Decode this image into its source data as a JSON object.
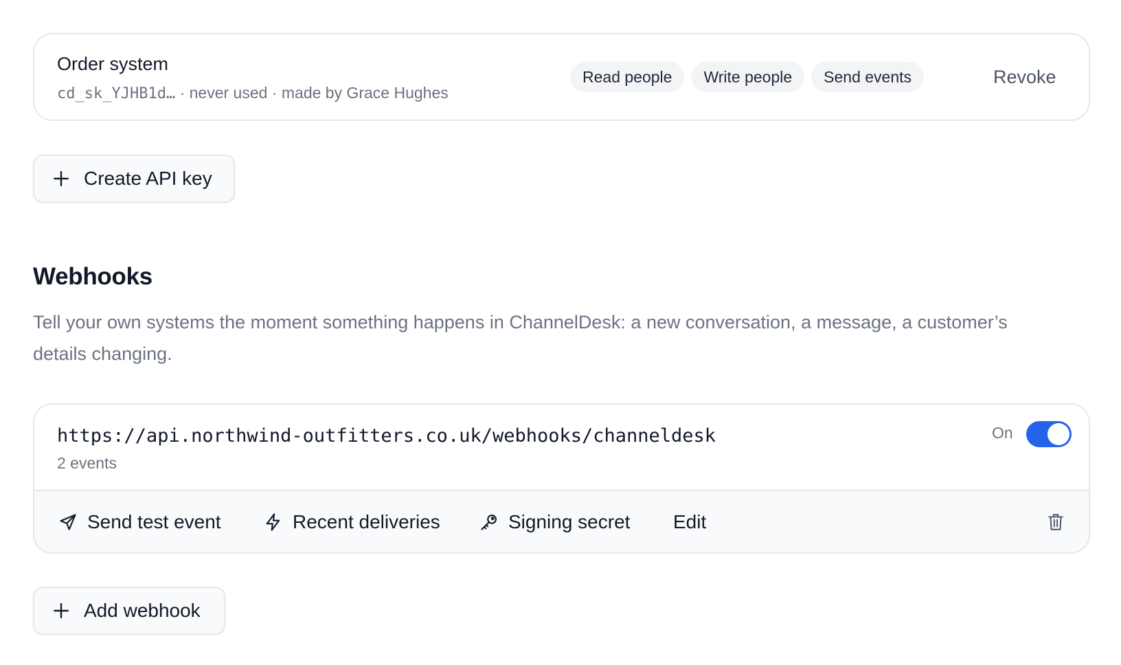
{
  "api_key": {
    "name": "Order system",
    "key_prefix": "cd_sk_YJHB1d…",
    "meta": " · never used · made by Grace Hughes",
    "scopes": [
      "Read people",
      "Write people",
      "Send events"
    ],
    "revoke_label": "Revoke"
  },
  "create_api_key_label": "Create API key",
  "webhooks": {
    "title": "Webhooks",
    "description": "Tell your own systems the moment something happens in ChannelDesk: a new conversation, a message, a customer’s details changing.",
    "items": [
      {
        "url": "https://api.northwind-outfitters.co.uk/webhooks/channeldesk",
        "events": "2 events",
        "toggle_label": "On",
        "enabled": true,
        "actions": {
          "send_test": "Send test event",
          "recent": "Recent deliveries",
          "secret": "Signing secret",
          "edit": "Edit"
        }
      }
    ],
    "add_label": "Add webhook"
  },
  "colors": {
    "accent": "#2563eb",
    "border": "#e5e7eb",
    "muted_text": "#6b7280",
    "chip_bg": "#f3f4f6"
  },
  "icons": [
    "plus-icon",
    "send-icon",
    "zap-icon",
    "key-icon",
    "trash-icon"
  ]
}
